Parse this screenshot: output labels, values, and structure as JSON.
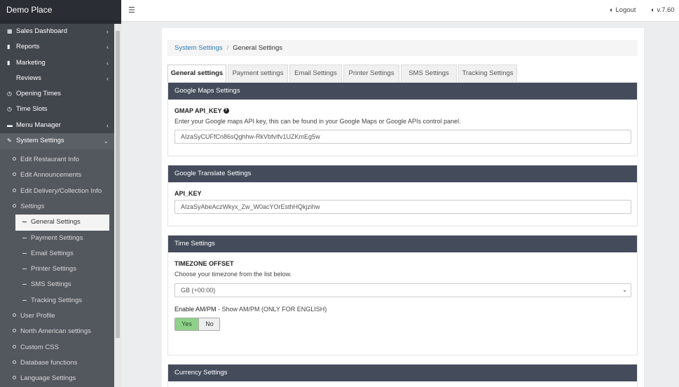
{
  "brand": "Demo Place",
  "topbar": {
    "menu_icon": "hamburger-icon",
    "logout_label": "Logout",
    "version": "v.7.60"
  },
  "sidebar": {
    "items": [
      {
        "label": "Sales Dashboard",
        "icon": "table-icon",
        "chevron": true
      },
      {
        "label": "Reports",
        "icon": "bar-chart-icon",
        "chevron": true
      },
      {
        "label": "Marketing",
        "icon": "bar-chart-icon",
        "chevron": true
      },
      {
        "label": "Reviews",
        "icon": "",
        "chevron": true
      },
      {
        "label": "Opening Times",
        "icon": "clock-icon",
        "chevron": false
      },
      {
        "label": "Time Slots",
        "icon": "clock-icon",
        "chevron": false
      },
      {
        "label": "Menu Manager",
        "icon": "folder-icon",
        "chevron": true
      },
      {
        "label": "System Settings",
        "icon": "wrench-icon",
        "chevron": true
      }
    ],
    "system_sub": [
      "Edit Restaurant Info",
      "Edit Announcements",
      "Edit Delivery/Collection Info",
      "Settings"
    ],
    "settings_sub": [
      "General Settings",
      "Payment Settings",
      "Email Settings",
      "Printer Settings",
      "SMS Settings",
      "Tracking Settings"
    ],
    "more_sub": [
      "User Profile",
      "North American settings",
      "Custom CSS",
      "Database functions",
      "Language Settings"
    ]
  },
  "breadcrumb": {
    "parent": "System Settings",
    "current": "General Settings"
  },
  "tabs": [
    "General settings",
    "Payment settings",
    "Email Settings",
    "Printer Settings",
    "SMS Settings",
    "Tracking Settings"
  ],
  "maps": {
    "header": "Google Maps Settings",
    "label": "GMAP API_KEY",
    "help": "Enter your Google maps API key, this can be found in your Google Maps or Google APIs control panel.",
    "value": "AIzaSyCUFfCn86sQghhw-RkVbfvIfv1UZKmEg5w"
  },
  "translate": {
    "header": "Google Translate Settings",
    "label": "API_KEY",
    "value": "AIzaSyAbeAczWkyx_Zw_W0acYOrEsthHQkjzihw"
  },
  "time": {
    "header": "Time Settings",
    "label": "TIMEZONE OFFSET",
    "help": "Choose your timezone from the list below.",
    "timezone": "GB (+00:00)",
    "ampm_label": "Enable AM/PM",
    "ampm_help": " - Show AM/PM (ONLY FOR ENGLISH)",
    "yes": "Yes",
    "no": "No",
    "ampm_selected": "Yes"
  },
  "currency": {
    "header": "Currency Settings"
  },
  "colors": {
    "sidebar_bg": "#41454c",
    "section_header": "#444c5c",
    "link": "#2a7ab8",
    "toggle_on": "#8fd18a"
  }
}
